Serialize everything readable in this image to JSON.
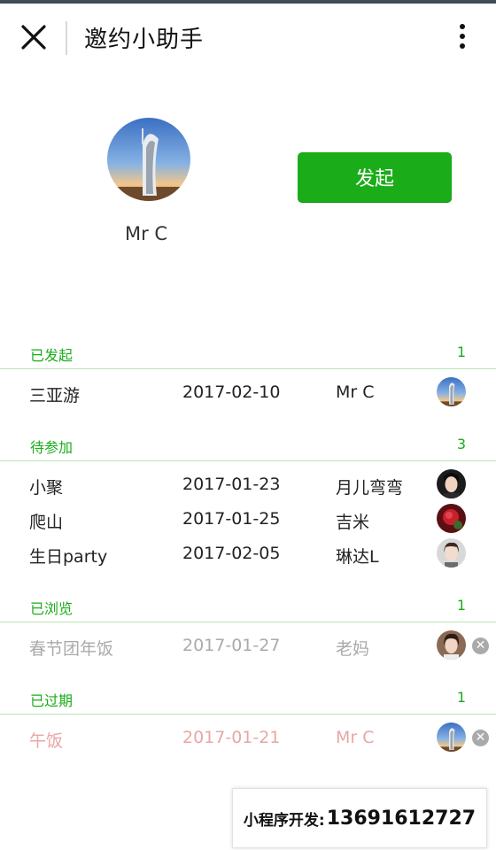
{
  "header": {
    "title": "邀约小助手"
  },
  "profile": {
    "name": "Mr C",
    "start_button": "发起"
  },
  "colors": {
    "accent": "#1aad19",
    "muted": "#aaaaaa",
    "expired": "#e8a7a7"
  },
  "sections": {
    "started": {
      "title": "已发起",
      "count": "1",
      "rows": [
        {
          "name": "三亚游",
          "date": "2017-02-10",
          "host": "Mr C",
          "avatar": "burj-tower"
        }
      ]
    },
    "pending": {
      "title": "待参加",
      "count": "3",
      "rows": [
        {
          "name": "小聚",
          "date": "2017-01-23",
          "host": "月儿弯弯",
          "avatar": "woman-dark-hair"
        },
        {
          "name": "爬山",
          "date": "2017-01-25",
          "host": "吉米",
          "avatar": "red-flower"
        },
        {
          "name": "生日party",
          "date": "2017-02-05",
          "host": "琳达L",
          "avatar": "woman-light"
        }
      ]
    },
    "viewed": {
      "title": "已浏览",
      "count": "1",
      "rows": [
        {
          "name": "春节团年饭",
          "date": "2017-01-27",
          "host": "老妈",
          "avatar": "woman-portrait"
        }
      ]
    },
    "expired": {
      "title": "已过期",
      "count": "1",
      "rows": [
        {
          "name": "午饭",
          "date": "2017-01-21",
          "host": "Mr C",
          "avatar": "burj-tower"
        }
      ]
    }
  },
  "footer": {
    "label": "小程序开发:",
    "phone": "13691612727"
  }
}
